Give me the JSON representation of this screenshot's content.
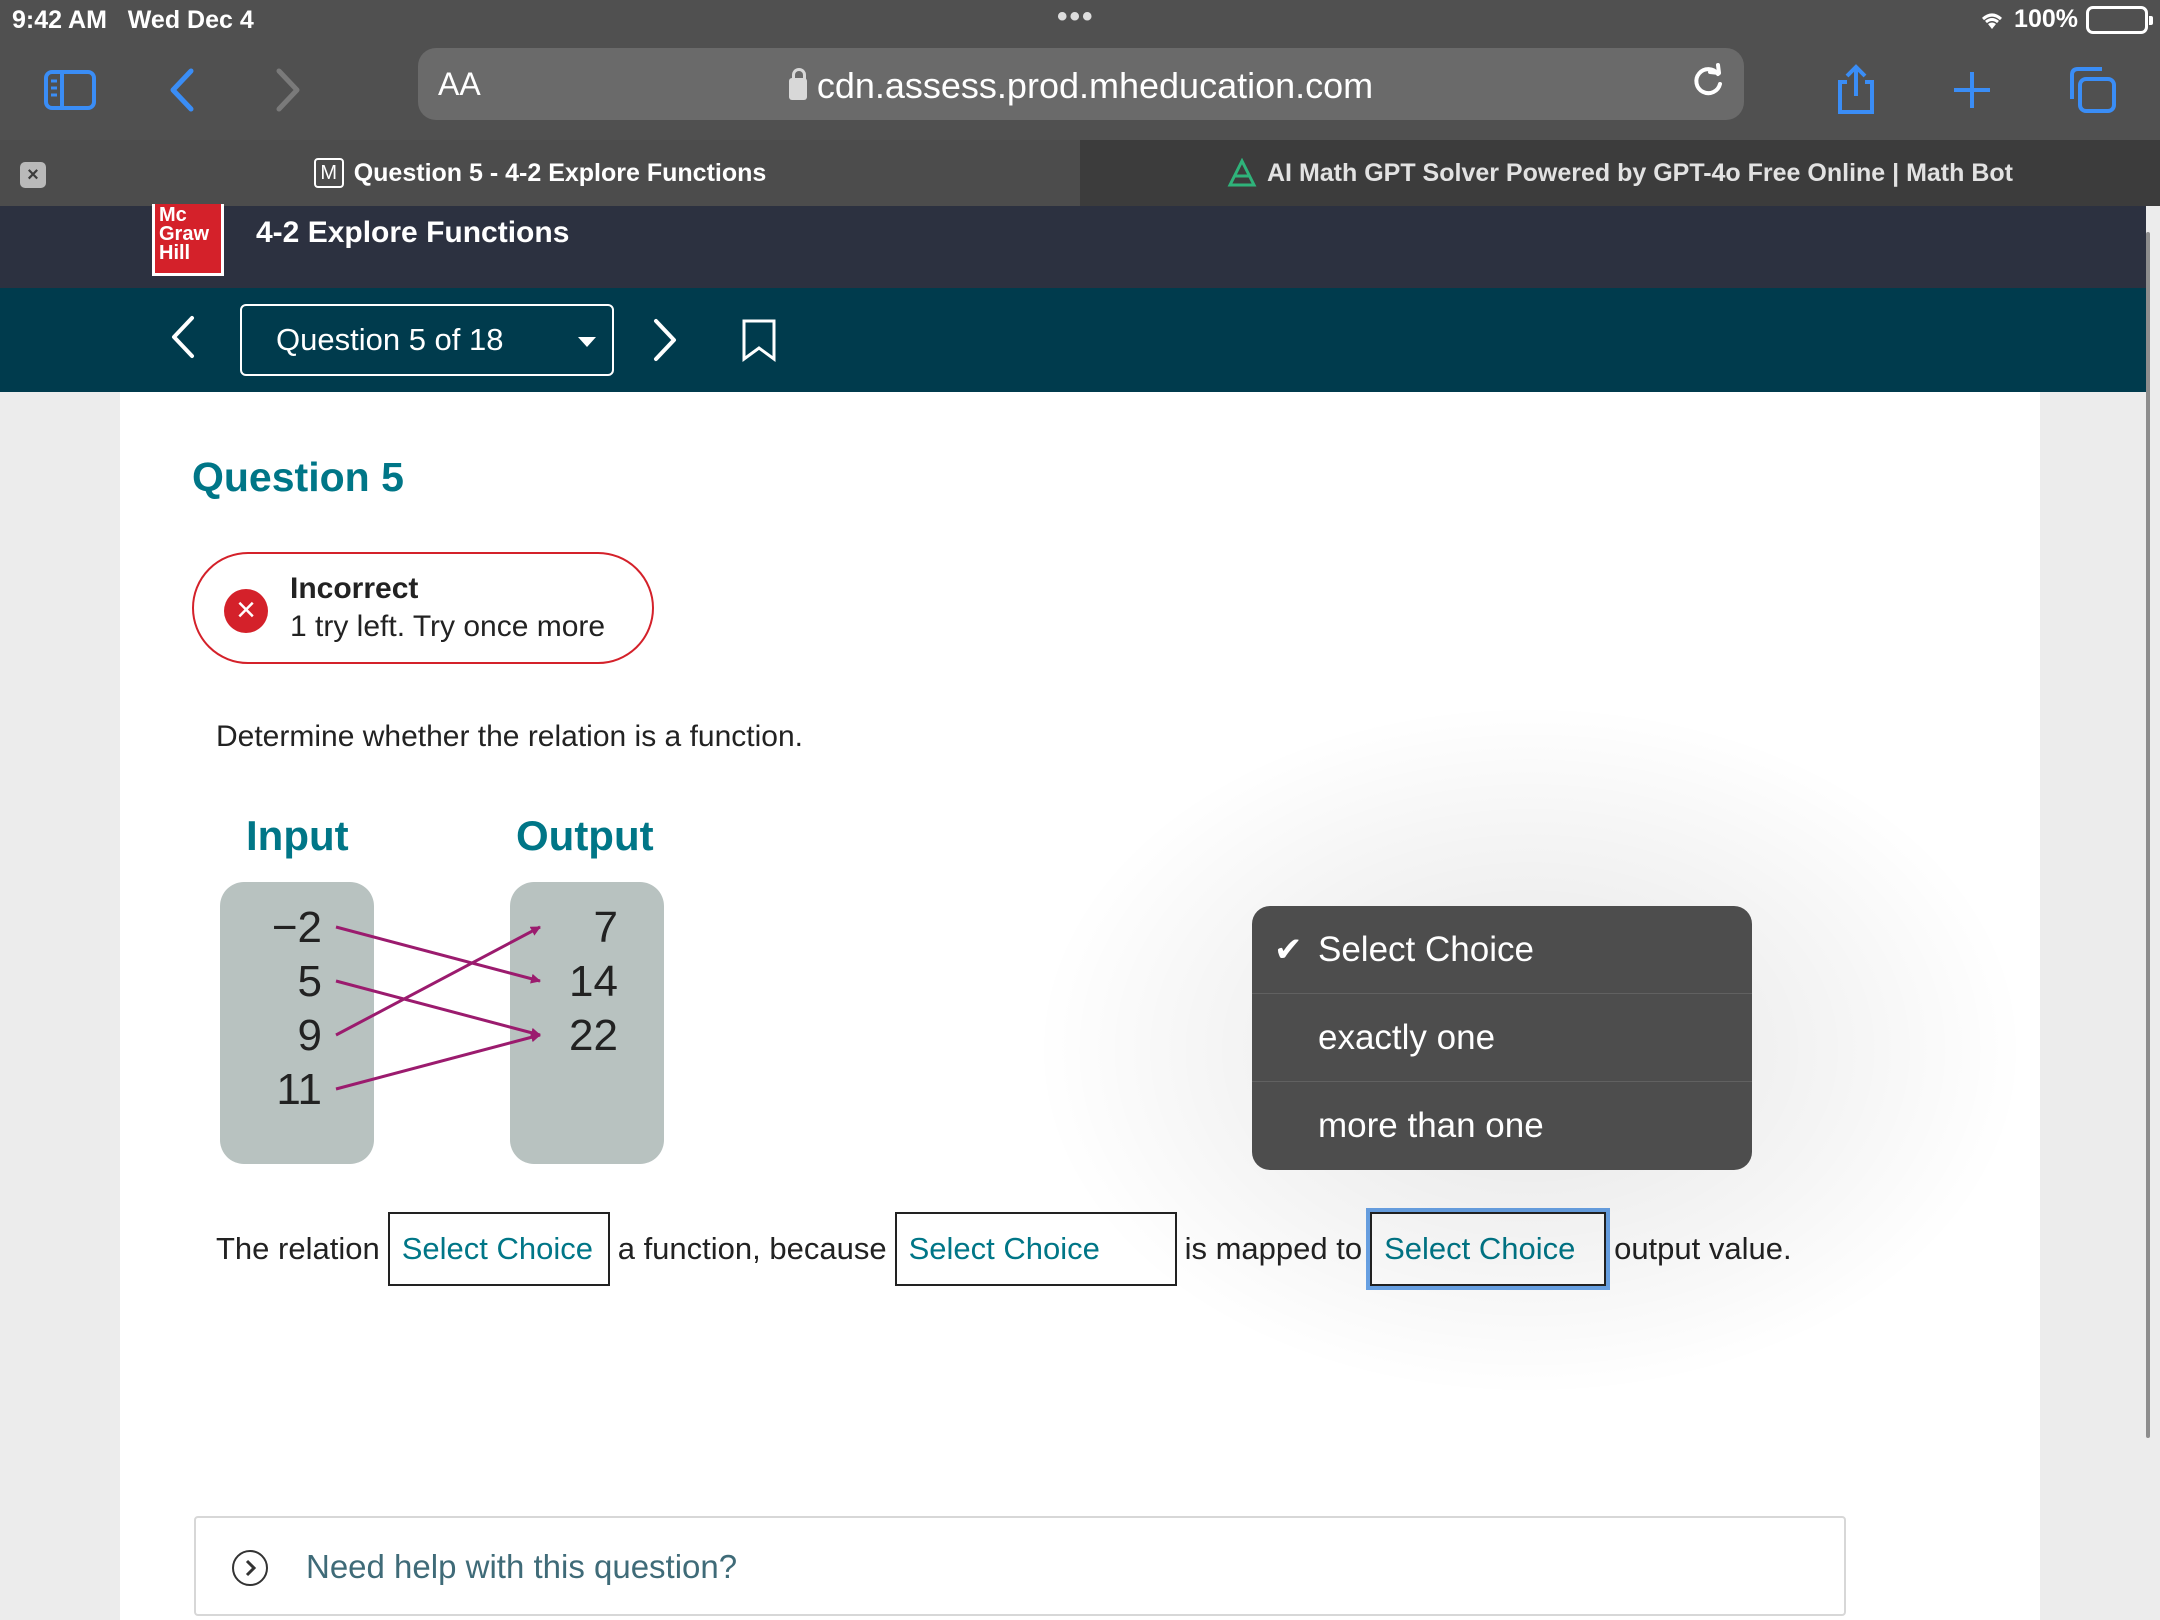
{
  "status": {
    "time": "9:42 AM",
    "date": "Wed Dec 4",
    "battery": "100%"
  },
  "browser": {
    "text_size_label": "AA",
    "url": "cdn.assess.prod.mheducation.com",
    "tabs": [
      {
        "favicon": "M",
        "label": "Question 5 - 4-2 Explore Functions",
        "active": true
      },
      {
        "label": "AI Math GPT Solver Powered by GPT-4o Free Online | Math Bot",
        "active": false
      }
    ]
  },
  "header": {
    "logo": [
      "Mc",
      "Graw",
      "Hill"
    ],
    "title": "4-2 Explore Functions"
  },
  "nav": {
    "question_selector": "Question 5 of 18"
  },
  "question": {
    "heading": "Question 5",
    "feedback_title": "Incorrect",
    "feedback_sub": "1 try left. Try once more",
    "prompt": "Determine whether the relation is a function."
  },
  "mapping": {
    "input_label": "Input",
    "output_label": "Output",
    "inputs": [
      "−2",
      "5",
      "9",
      "11"
    ],
    "outputs": [
      "7",
      "14",
      "22"
    ],
    "pairs": [
      [
        "−2",
        "14"
      ],
      [
        "5",
        "22"
      ],
      [
        "9",
        "7"
      ],
      [
        "11",
        "22"
      ]
    ],
    "arrow_color": "#9b1b6e"
  },
  "sentence": {
    "part1": "The relation",
    "select1": "Select Choice",
    "part2": "a function, because",
    "select2": "Select Choice",
    "part3": "is mapped to",
    "select3": "Select Choice",
    "part4": "output value."
  },
  "dropdown": {
    "options": [
      "Select Choice",
      "exactly one",
      "more than one"
    ],
    "selected": "Select Choice"
  },
  "help": {
    "label": "Need help with this question?"
  },
  "colors": {
    "accent": "#007687",
    "error": "#d4212a",
    "nav_bg": "#003b4d",
    "header_bg": "#2c3140"
  }
}
